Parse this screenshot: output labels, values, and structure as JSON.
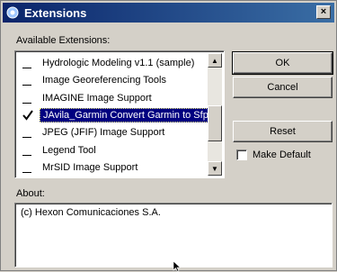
{
  "window": {
    "title": "Extensions",
    "close_glyph": "×"
  },
  "available_label": "Available Extensions:",
  "extensions": [
    {
      "label": "Hydrologic Modeling v1.1 (sample)",
      "checked": false,
      "selected": false
    },
    {
      "label": "Image Georeferencing Tools",
      "checked": false,
      "selected": false
    },
    {
      "label": "IMAGINE Image Support",
      "checked": false,
      "selected": false
    },
    {
      "label": "JAvila_Garmin Convert Garmin to Sfp",
      "checked": true,
      "selected": true
    },
    {
      "label": "JPEG (JFIF) Image Support",
      "checked": false,
      "selected": false
    },
    {
      "label": "Legend Tool",
      "checked": false,
      "selected": false
    },
    {
      "label": "MrSID Image Support",
      "checked": false,
      "selected": false
    }
  ],
  "buttons": {
    "ok": "OK",
    "cancel": "Cancel",
    "reset": "Reset"
  },
  "make_default_label": "Make Default",
  "about_label": "About:",
  "about_text": "(c) Hexon Comunicaciones S.A.",
  "icons": {
    "title": "extension-icon",
    "scroll_up": "▲",
    "scroll_down": "▼"
  }
}
